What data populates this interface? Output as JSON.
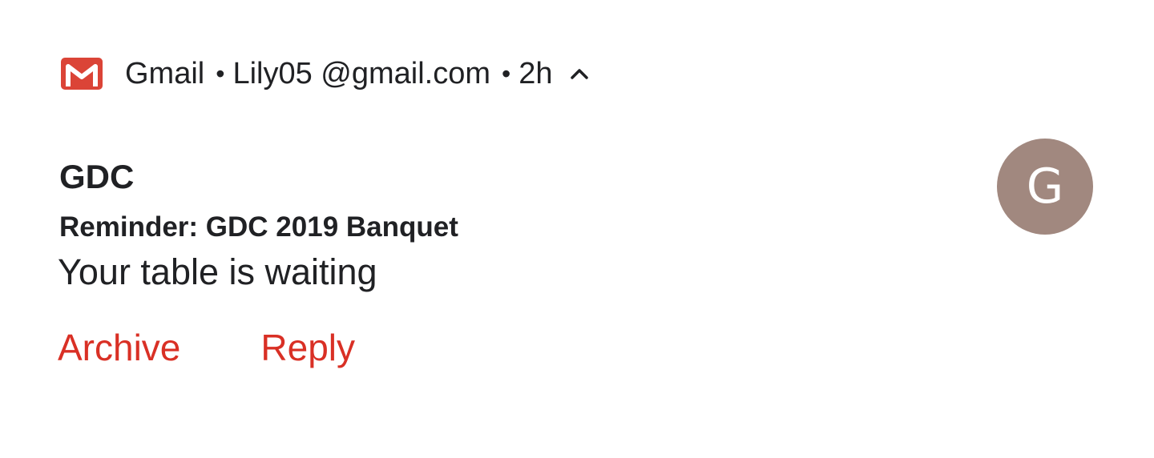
{
  "notification": {
    "app_name": "Gmail",
    "separator": "•",
    "account": "Lily05 @gmail.com",
    "time": "2h",
    "sender": "GDC",
    "subject": "Reminder: GDC 2019  Banquet",
    "body": "Your table is waiting",
    "avatar_letter": "G",
    "actions": {
      "archive_label": "Archive",
      "reply_label": "Reply"
    },
    "icons": {
      "app_icon": "gmail-logo-icon",
      "expand_icon": "chevron-up-icon"
    },
    "colors": {
      "gmail_red": "#db4437",
      "action_red": "#d93025",
      "avatar_bg": "#a1887f",
      "text": "#202124"
    }
  }
}
